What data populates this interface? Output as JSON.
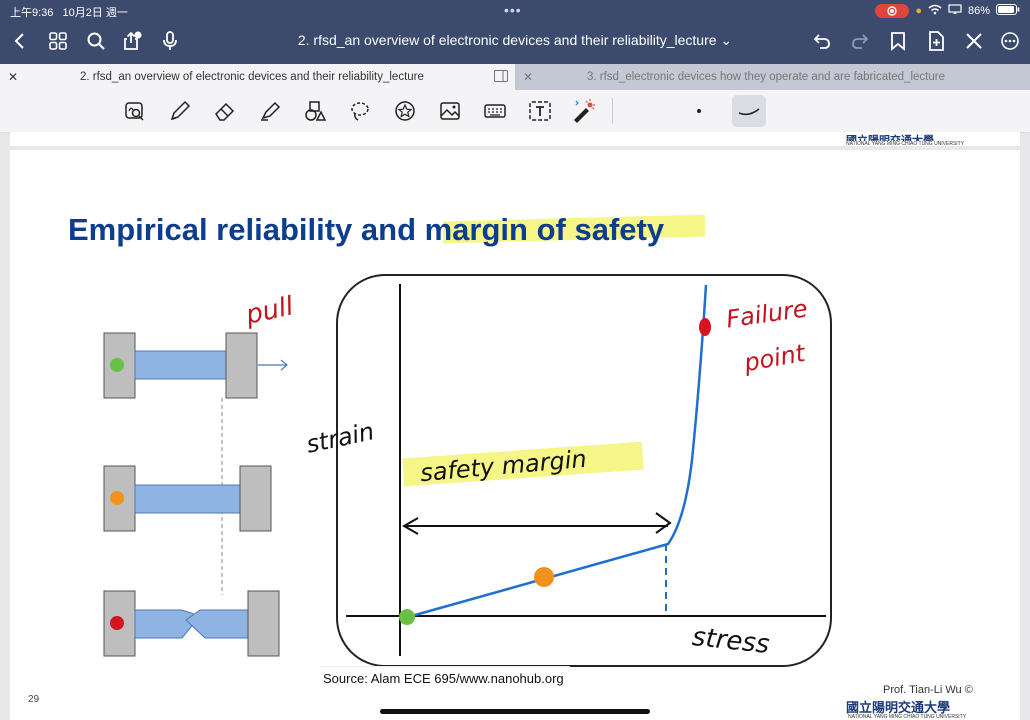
{
  "status": {
    "time": "上午9:36",
    "date": "10月2日 週一",
    "battery": "86%"
  },
  "header": {
    "title": "2. rfsd_an overview of electronic devices and their reliability_lecture ⌄"
  },
  "tabs": [
    {
      "label": "2. rfsd_an overview of electronic devices and their reliability_lecture",
      "active": true
    },
    {
      "label": "3. rfsd_electronic devices how they operate and are fabricated_lecture",
      "active": false
    }
  ],
  "toolbar": {
    "tools": [
      "lasso-zoom-icon",
      "pen-icon",
      "eraser-icon",
      "highlighter-icon",
      "shapes-icon",
      "lasso-icon",
      "sticker-icon",
      "image-icon",
      "keyboard-icon",
      "text-box-icon",
      "laser-pointer-icon"
    ]
  },
  "slide": {
    "title": "Empirical reliability and margin of safety",
    "source": "Source: Alam ECE 695/www.nanohub.org",
    "author": "Prof. Tian-Li Wu ©",
    "university": "國立陽明交通大學",
    "university_en": "NATIONAL YANG MING CHIAO TUNG UNIVERSITY",
    "page": "29"
  },
  "annotations": {
    "pull": "pull",
    "strain": "strain",
    "stress": "stress",
    "safety_margin": "safety margin",
    "failure_point": [
      "Failure",
      "point"
    ]
  },
  "colors": {
    "title": "#0c3d8f",
    "curve": "#1f6fd1",
    "ink_red": "#c0141e",
    "highlight": "#f2f26a"
  }
}
